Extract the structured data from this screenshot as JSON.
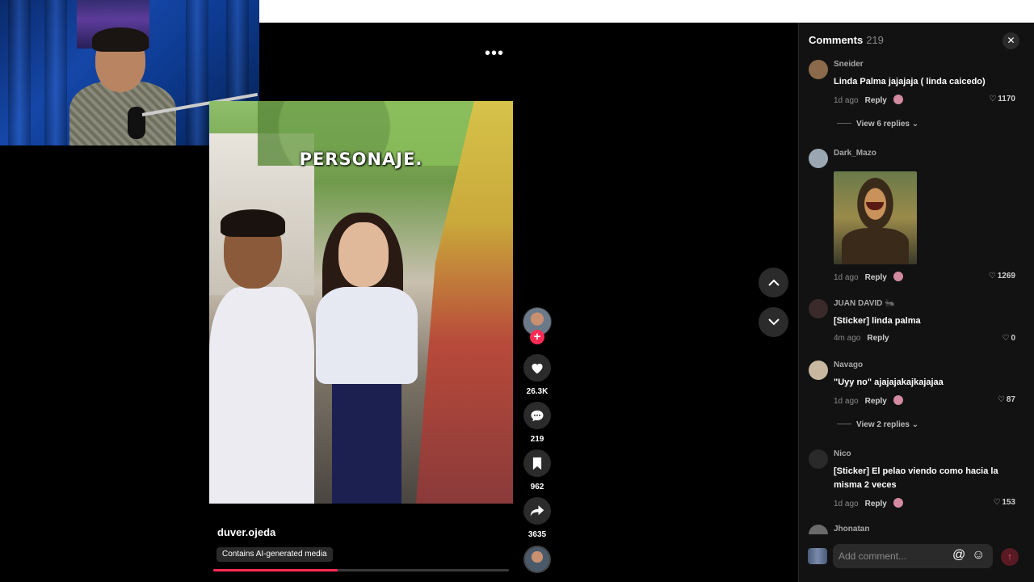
{
  "video": {
    "overlay_text": "PERSONAJE.",
    "author": "duver.ojeda",
    "ai_label": "Contains AI-generated media",
    "progress_fraction": 0.42
  },
  "actions": {
    "likes": "26.3K",
    "comments": "219",
    "saves": "962",
    "shares": "3635"
  },
  "comments_panel": {
    "title": "Comments",
    "count": "219",
    "items": [
      {
        "user": "Sneider",
        "text": "Linda Palma jajajaja ( linda caicedo)",
        "time": "1d ago",
        "reply": "Reply",
        "likes": "1170",
        "view_replies": "View 6 replies",
        "avatar_color": "#8a6a4a"
      },
      {
        "user": "Dark_Mazo",
        "text": "",
        "time": "1d ago",
        "reply": "Reply",
        "likes": "1269",
        "avatar_color": "#9aa6b2"
      },
      {
        "user": "JUAN DAVID 🐜",
        "text": "[Sticker] linda palma",
        "time": "4m ago",
        "reply": "Reply",
        "likes": "0",
        "avatar_color": "#3a2a2a"
      },
      {
        "user": "Navago",
        "text": "\"Uyy no\" ajajajakajkajajaa",
        "time": "1d ago",
        "reply": "Reply",
        "likes": "87",
        "view_replies": "View 2 replies",
        "avatar_color": "#c8b8a0"
      },
      {
        "user": "Nico",
        "text": "[Sticker] El pelao viendo como hacia la misma 2 veces",
        "time": "1d ago",
        "reply": "Reply",
        "likes": "153",
        "avatar_color": "#2a2a2a"
      },
      {
        "user": "Jhonatan",
        "avatar_color": "#6a6a6a"
      }
    ],
    "add_placeholder": "Add comment..."
  }
}
